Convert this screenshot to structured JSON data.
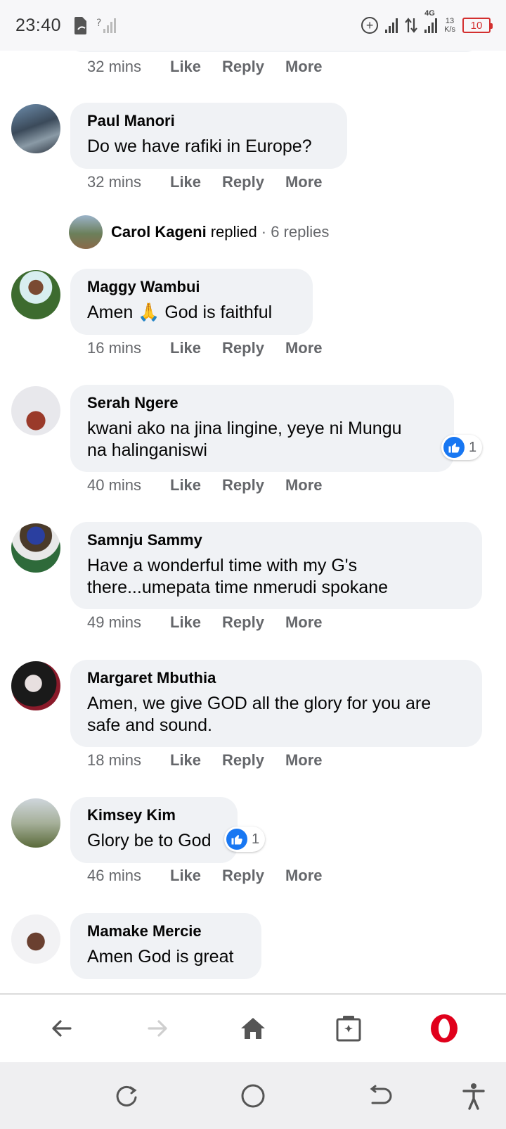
{
  "status_bar": {
    "time": "23:40",
    "network": "4G",
    "net_speed_value": "13",
    "net_speed_unit": "K/s",
    "battery": "10"
  },
  "actions": {
    "like": "Like",
    "reply": "Reply",
    "more": "More"
  },
  "top_meta": {
    "time": "32 mins"
  },
  "comments": [
    {
      "author": "Paul Manori",
      "text": "Do we have rafiki in Europe?",
      "time": "32 mins"
    },
    {
      "author": "Maggy Wambui",
      "text": "Amen 🙏 God is faithful",
      "time": "16 mins"
    },
    {
      "author": "Serah Ngere",
      "text_line1": "kwani ako na jina lingine, yeye ni Mungu",
      "text_line2": "na halinganiswi",
      "time": "40 mins",
      "reactions": "1"
    },
    {
      "author": "Samnju Sammy",
      "text_line1": "Have a wonderful time with my G's",
      "text_line2": "there...umepata time nmerudi spokane",
      "time": "49 mins"
    },
    {
      "author": "Margaret Mbuthia",
      "text_line1": "Amen, we give GOD all the glory for you are",
      "text_line2": "safe and sound.",
      "time": "18 mins"
    },
    {
      "author": "Kimsey Kim",
      "text": "Glory be to God",
      "time": "46 mins",
      "reactions": "1"
    },
    {
      "author": "Mamake Mercie",
      "text": "Amen God is great"
    }
  ],
  "replies_summary": {
    "name": "Carol Kageni",
    "action": "replied",
    "count": "· 6 replies"
  },
  "colors": {
    "bubble": "#f0f2f5",
    "meta_text": "#65676b",
    "like_blue": "#1877f2",
    "opera_red": "#e0001b",
    "battery_red": "#d32f2f"
  },
  "icons": {
    "browser_bar": [
      "back-arrow-icon",
      "forward-arrow-icon",
      "home-icon",
      "tabs-icon",
      "opera-logo-icon"
    ],
    "nav_bar": [
      "recents-icon",
      "home-circle-icon",
      "back-icon",
      "accessibility-icon"
    ]
  }
}
